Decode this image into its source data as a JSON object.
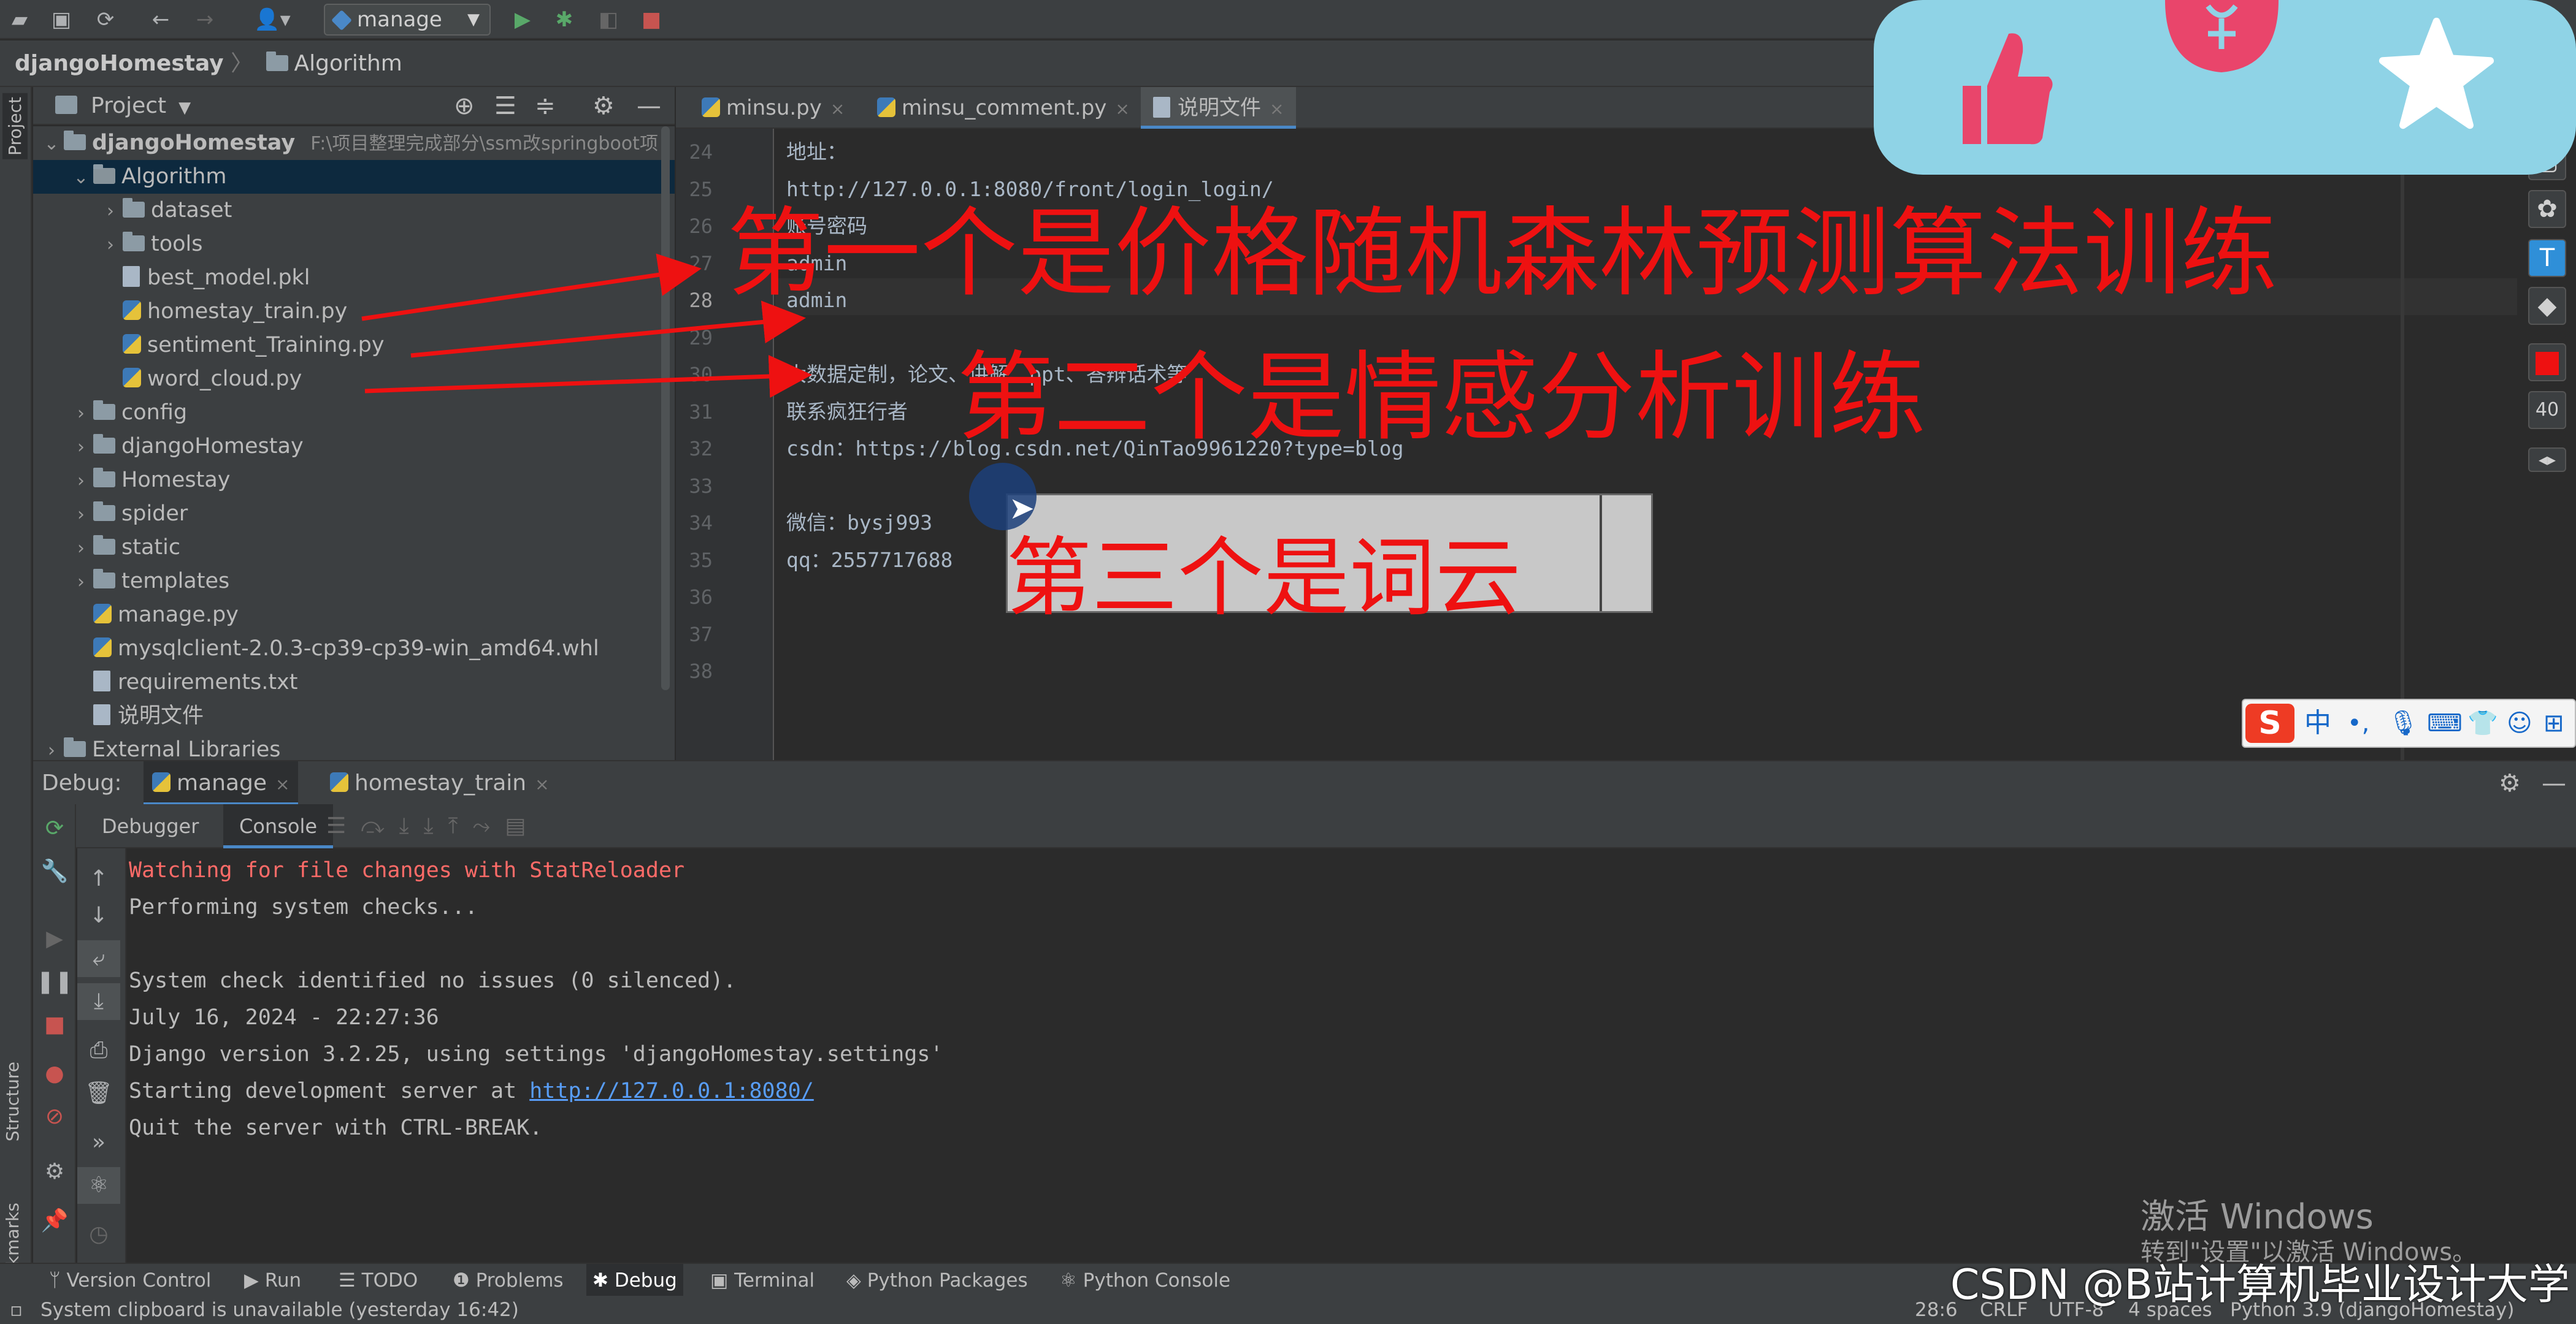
{
  "toolbar": {
    "run_config": "manage"
  },
  "breadcrumb": {
    "project": "djangoHomestay",
    "folder": "Algorithm"
  },
  "project_panel": {
    "title": "Project",
    "root_name": "djangoHomestay",
    "root_path": "F:\\项目整理完成部分\\ssm改springboot项",
    "items": [
      {
        "label": "Algorithm",
        "depth": 1,
        "kind": "folder",
        "expanded": true
      },
      {
        "label": "dataset",
        "depth": 2,
        "kind": "folder"
      },
      {
        "label": "tools",
        "depth": 2,
        "kind": "folder"
      },
      {
        "label": "best_model.pkl",
        "depth": 2,
        "kind": "file"
      },
      {
        "label": "homestay_train.py",
        "depth": 2,
        "kind": "py"
      },
      {
        "label": "sentiment_Training.py",
        "depth": 2,
        "kind": "py"
      },
      {
        "label": "word_cloud.py",
        "depth": 2,
        "kind": "py"
      },
      {
        "label": "config",
        "depth": 1,
        "kind": "folder"
      },
      {
        "label": "djangoHomestay",
        "depth": 1,
        "kind": "folder"
      },
      {
        "label": "Homestay",
        "depth": 1,
        "kind": "folder"
      },
      {
        "label": "spider",
        "depth": 1,
        "kind": "folder"
      },
      {
        "label": "static",
        "depth": 1,
        "kind": "folder"
      },
      {
        "label": "templates",
        "depth": 1,
        "kind": "folder"
      },
      {
        "label": "manage.py",
        "depth": 1,
        "kind": "py"
      },
      {
        "label": "mysqlclient-2.0.3-cp39-cp39-win_amd64.whl",
        "depth": 1,
        "kind": "py"
      },
      {
        "label": "requirements.txt",
        "depth": 1,
        "kind": "file"
      },
      {
        "label": "说明文件",
        "depth": 1,
        "kind": "file"
      },
      {
        "label": "External Libraries",
        "depth": 0,
        "kind": "folder"
      }
    ]
  },
  "editor": {
    "tabs": [
      {
        "label": "minsu.py"
      },
      {
        "label": "minsu_comment.py"
      },
      {
        "label": "说明文件",
        "active": true
      }
    ],
    "lines": [
      {
        "n": "24",
        "text": "地址："
      },
      {
        "n": "25",
        "text": "http://127.0.0.1:8080/front/login_login/"
      },
      {
        "n": "26",
        "text": "账号密码"
      },
      {
        "n": "27",
        "text": "admin"
      },
      {
        "n": "28",
        "text": "admin"
      },
      {
        "n": "29",
        "text": ""
      },
      {
        "n": "30",
        "text": "大数据定制，论文、讲解、ppt、答辩话术等"
      },
      {
        "n": "31",
        "text": "联系疯狂行者"
      },
      {
        "n": "32",
        "text": "csdn：https://blog.csdn.net/QinTao9961220?type=blog"
      },
      {
        "n": "33",
        "text": ""
      },
      {
        "n": "34",
        "text": "微信：bysj993"
      },
      {
        "n": "35",
        "text": "qq：2557717688"
      },
      {
        "n": "36",
        "text": ""
      },
      {
        "n": "37",
        "text": ""
      },
      {
        "n": "38",
        "text": ""
      }
    ]
  },
  "annotations": {
    "first": "第一个是价格随机森林预测算法训练",
    "second": "第二个是情感分析训练",
    "third": "第三个是词云"
  },
  "right_tools": {
    "size": "40"
  },
  "ime": {
    "mode": "中"
  },
  "debug": {
    "label": "Debug:",
    "sessions": [
      {
        "label": "manage"
      },
      {
        "label": "homestay_train"
      }
    ],
    "tabs": [
      {
        "label": "Debugger"
      },
      {
        "label": "Console",
        "active": true
      }
    ],
    "console": [
      {
        "text": "Watching for file changes with StatReloader",
        "err": true
      },
      {
        "text": "Performing system checks..."
      },
      {
        "text": ""
      },
      {
        "text": "System check identified no issues (0 silenced)."
      },
      {
        "text": "July 16, 2024 - 22:27:36"
      },
      {
        "text": "Django version 3.2.25, using settings 'djangoHomestay.settings'"
      },
      {
        "text": "Starting development server at ",
        "link": "http://127.0.0.1:8080/"
      },
      {
        "text": "Quit the server with CTRL-BREAK."
      }
    ]
  },
  "left_strip": {
    "project": "Project",
    "structure": "Structure",
    "bookmarks": "Bookmarks"
  },
  "bottom_tools": [
    {
      "label": "Version Control"
    },
    {
      "label": "Run"
    },
    {
      "label": "TODO"
    },
    {
      "label": "Problems"
    },
    {
      "label": "Debug",
      "active": true
    },
    {
      "label": "Terminal"
    },
    {
      "label": "Python Packages"
    },
    {
      "label": "Python Console"
    }
  ],
  "status": {
    "message": "System clipboard is unavailable (yesterday 16:42)",
    "position": "28:6",
    "line_sep": "CRLF",
    "encoding": "UTF-8",
    "indent": "4 spaces",
    "interpreter": "Python 3.9 (djangoHomestay)"
  },
  "overlay": {
    "activate_title": "激活 Windows",
    "activate_sub": "转到\"设置\"以激活 Windows。",
    "watermark": "CSDN @B站计算机毕业设计大学"
  }
}
